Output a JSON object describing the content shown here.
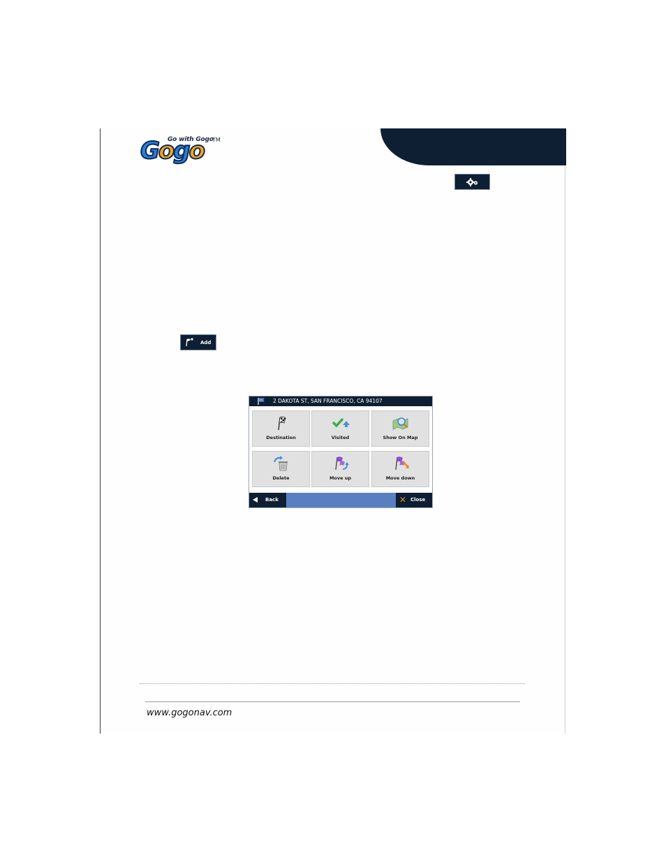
{
  "logo": {
    "tagline": "Go with Gogo",
    "tm": "TM",
    "word_g": "G",
    "word_o1": "o",
    "word_g2": "g",
    "word_o2": "o"
  },
  "toolbar": {
    "settings_icon": "gear-icon",
    "add_label": "Add",
    "add_icon": "flag-plus-icon"
  },
  "dialog": {
    "title": "2 DAKOTA ST, SAN FRANCISCO, CA 94107",
    "tiles": [
      {
        "label": "Destination",
        "icon": "checkered-flag-icon"
      },
      {
        "label": "Visited",
        "icon": "check-visited-icon"
      },
      {
        "label": "Show On Map",
        "icon": "map-magnifier-icon"
      },
      {
        "label": "Delete",
        "icon": "trash-icon"
      },
      {
        "label": "Move up",
        "icon": "move-up-icon"
      },
      {
        "label": "Move down",
        "icon": "move-down-icon"
      }
    ],
    "back_label": "Back",
    "close_label": "Close"
  },
  "footer": {
    "url": "www.gogonav.com"
  },
  "colors": {
    "navy": "#0e1f33",
    "bar_blue": "#5a7fc0",
    "tile_gray": "#e1e1e1",
    "accent_orange": "#f08a1e"
  }
}
